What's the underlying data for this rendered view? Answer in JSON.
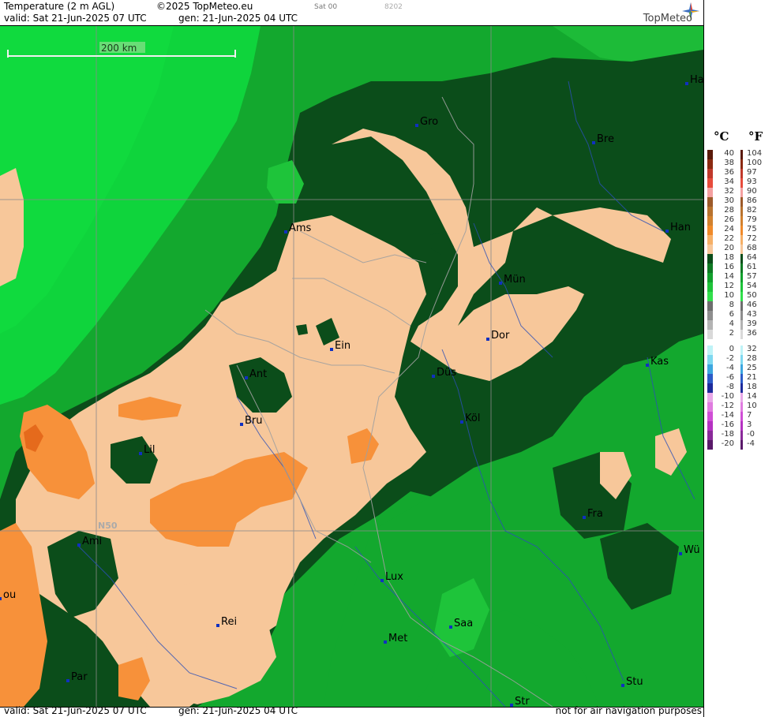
{
  "header": {
    "title": "Temperature (2 m AGL)",
    "copyright": "©2025 TopMeteo.eu",
    "run_step": "Sat 00",
    "code": "8202",
    "valid": "valid:  Sat  21-Jun-2025  07 UTC",
    "gen": "gen:  21-Jun-2025 04 UTC",
    "logo": "TopMeteo"
  },
  "footer": {
    "valid": "valid:  Sat  21-Jun-2025  07 UTC",
    "gen": "gen: 21-Jun-2025 04 UTC",
    "disclaimer": "not for air navigation purposes"
  },
  "map": {
    "scale_label": "200 km",
    "lat_label": "N50",
    "cities": [
      "Ha",
      "Gro",
      "Bre",
      "Ams",
      "Han",
      "Mün",
      "Ein",
      "Dor",
      "Düs",
      "Kas",
      "Ant",
      "Köl",
      "Bru",
      "Lil",
      "Fra",
      "Ami",
      "Wü",
      "Lux",
      "ou",
      "Saa",
      "Rei",
      "Met",
      "Stu",
      "Par",
      "Str"
    ]
  },
  "legend": {
    "celsius_unit": "°C",
    "fahrenheit_unit": "°F",
    "celsius": [
      "40",
      "38",
      "36",
      "34",
      "32",
      "30",
      "28",
      "26",
      "24",
      "22",
      "20",
      "18",
      "16",
      "14",
      "12",
      "10",
      "8",
      "6",
      "4",
      "2",
      "0",
      "-2",
      "-4",
      "-6",
      "-8",
      "-10",
      "-12",
      "-14",
      "-16",
      "-18",
      "-20"
    ],
    "fahrenheit": [
      "104",
      "100",
      "97",
      "93",
      "90",
      "86",
      "82",
      "79",
      "75",
      "72",
      "68",
      "64",
      "61",
      "57",
      "54",
      "50",
      "46",
      "43",
      "39",
      "36",
      "32",
      "28",
      "25",
      "21",
      "18",
      "14",
      "10",
      "7",
      "3",
      "-0",
      "-4"
    ],
    "colors": [
      "#5a1a0a",
      "#8b2a12",
      "#c0392b",
      "#e74c3c",
      "#f4a0a0",
      "#9c5a2a",
      "#b8732f",
      "#d2812e",
      "#f08a2a",
      "#f6b067",
      "#f7c79a",
      "#0b4d1a",
      "#0f7a24",
      "#12a12d",
      "#1ec43a",
      "#32e04c",
      "#6e6e6e",
      "#8e8e8e",
      "#b3b3b3",
      "#d9d9d9",
      "#bff3f7",
      "#7fd8f0",
      "#3ea7e0",
      "#2c5cc8",
      "#1d2b9c",
      "#e8a8e8",
      "#e07ce0",
      "#d04ed6",
      "#b532c2",
      "#8a2a9a",
      "#5a1a6a"
    ]
  }
}
